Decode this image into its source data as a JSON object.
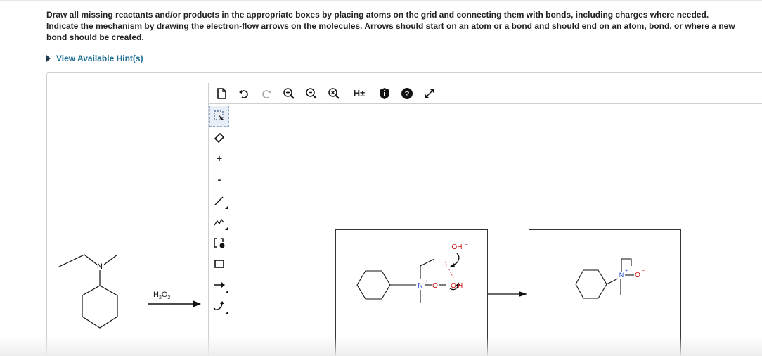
{
  "instructions": "Draw all missing reactants and/or products in the appropriate boxes by placing atoms on the grid and connecting them with bonds, including charges where needed. Indicate the mechanism by drawing the electron-flow arrows on the molecules. Arrows should start on an atom or a bond and should end on an atom, bond, or where a new bond should be created.",
  "hint": {
    "label": "View Available Hint(s)"
  },
  "toolbar": {
    "icons": [
      "new-document-icon",
      "undo-icon",
      "redo-icon",
      "zoom-in-icon",
      "zoom-out-icon",
      "zoom-reset-icon",
      "explicit-hydrogens-icon",
      "info-icon",
      "help-icon",
      "fullscreen-icon"
    ],
    "hydrogen_label": "H±"
  },
  "side_tools": {
    "icons": [
      "select-lasso-icon",
      "eraser-icon",
      "positive-charge-icon",
      "negative-charge-icon",
      "single-bond-icon",
      "chain-icon",
      "bracket-icon",
      "rectangle-icon",
      "reaction-arrow-icon",
      "curved-arrow-icon"
    ],
    "plus_label": "+",
    "minus_label": "-"
  },
  "reactant": {
    "atom_label": "N",
    "reagent_label_main": "H",
    "reagent_sub1": "2",
    "reagent_label_mid": "O",
    "reagent_sub2": "2"
  },
  "intermediate": {
    "nitrogen": "N",
    "nitrogen_charge": "+",
    "oxygen1": "O",
    "oxygen2": "O",
    "hydrogen": "H",
    "hydroxide": "OH",
    "hydroxide_charge": "−"
  },
  "product": {
    "nitrogen": "N",
    "nitrogen_charge": "+",
    "oxygen": "O",
    "oxygen_charge": "−"
  },
  "colors": {
    "link": "#1f6f94",
    "nitrogen_blue": "#2244cc",
    "oxygen_red": "#cc1111",
    "border": "#cfcfcf"
  }
}
